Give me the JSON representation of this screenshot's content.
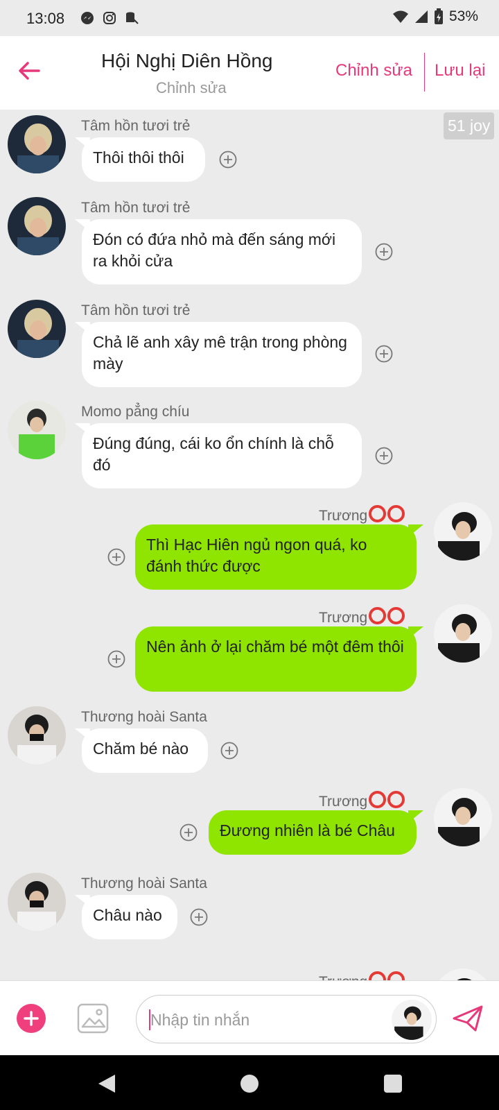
{
  "status_bar": {
    "time": "13:08",
    "battery": "53%"
  },
  "header": {
    "title": "Hội Nghị Diên Hồng",
    "subtitle": "Chỉnh sửa",
    "edit_label": "Chỉnh sửa",
    "save_label": "Lưu lại"
  },
  "chat": {
    "joy_badge": "51 joy",
    "messages": [
      {
        "sender": "Tâm hồn tươi trẻ",
        "text": "Thôi thôi thôi",
        "direction": "in"
      },
      {
        "sender": "Tâm hồn tươi trẻ",
        "text": "Đón có đứa nhỏ mà đến sáng mới ra khỏi cửa",
        "direction": "in"
      },
      {
        "sender": "Tâm hồn tươi trẻ",
        "text": "Chả lẽ anh xây mê trận trong phòng mày",
        "direction": "in"
      },
      {
        "sender": "Momo pẳng chíu",
        "text": "Đúng đúng, cái ko ổn chính là chỗ đó",
        "direction": "in"
      },
      {
        "sender": "Trương",
        "text": "Thì Hạc Hiên ngủ ngon quá, ko đánh thức được",
        "direction": "out"
      },
      {
        "sender": "Trương",
        "text": "Nên ảnh ở lại chăm bé một đêm thôi",
        "direction": "out"
      },
      {
        "sender": "Thương hoài Santa",
        "text": "Chăm bé nào",
        "direction": "in"
      },
      {
        "sender": "Trương",
        "text": "Đương nhiên là bé Châu",
        "direction": "out"
      },
      {
        "sender": "Thương hoài Santa",
        "text": "Châu nào",
        "direction": "in"
      },
      {
        "sender": "Trương",
        "text": "",
        "direction": "out"
      }
    ]
  },
  "input_bar": {
    "placeholder": "Nhập tin nhắn"
  },
  "colors": {
    "accent": "#e6397a",
    "outgoing_bubble": "#8fe400",
    "incoming_bubble": "#ffffff",
    "background": "#ebebeb"
  }
}
